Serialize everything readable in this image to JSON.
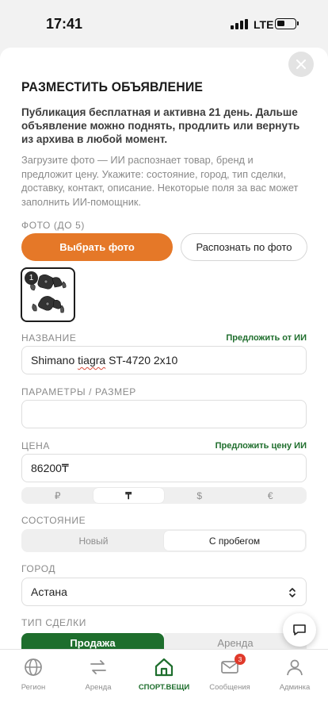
{
  "status_bar": {
    "time": "17:41",
    "network": "LTE"
  },
  "form": {
    "title": "РАЗМЕСТИТЬ ОБЪЯВЛЕНИЕ",
    "lead": "Публикация бесплатная и активна 21 день. Дальше объявление можно поднять, продлить или вернуть из архива в любой момент.",
    "hint": "Загрузите фото — ИИ распознает товар, бренд и предложит цену. Укажите: состояние, город, тип сделки, доставку, контакт, описание. Некоторые поля за вас может заполнить ИИ-помощник.",
    "photo": {
      "label": "ФОТО (ДО 5)",
      "choose_button": "Выбрать фото",
      "recognize_button": "Распознать по фото",
      "thumbnail_index": "1"
    },
    "name": {
      "label": "НАЗВАНИЕ",
      "ai_link": "Предложить от ИИ",
      "value_brand": "Shimano",
      "value_spell": "tiagra",
      "value_rest": "ST-4720 2x10"
    },
    "params": {
      "label": "ПАРАМЕТРЫ / РАЗМЕР",
      "value": ""
    },
    "price": {
      "label": "ЦЕНА",
      "ai_link": "Предложить цену ИИ",
      "value": "86200₸",
      "currencies": [
        "₽",
        "₸",
        "$",
        "€"
      ],
      "selected_currency": "₸"
    },
    "condition": {
      "label": "СОСТОЯНИЕ",
      "options": [
        "Новый",
        "С пробегом"
      ],
      "selected": "С пробегом"
    },
    "city": {
      "label": "ГОРОД",
      "value": "Астана"
    },
    "deal_type": {
      "label": "ТИП СДЕЛКИ",
      "options": [
        "Продажа",
        "Аренда"
      ],
      "selected": "Продажа"
    }
  },
  "tabbar": {
    "items": [
      {
        "label": "Регион",
        "icon": "globe-icon"
      },
      {
        "label": "Аренда",
        "icon": "swap-arrows-icon"
      },
      {
        "label": "СПОРТ.ВЕЩИ",
        "icon": "home-icon"
      },
      {
        "label": "Сообщения",
        "icon": "mail-icon",
        "badge": "3"
      },
      {
        "label": "Админка",
        "icon": "person-icon"
      }
    ],
    "active": "СПОРТ.ВЕЩИ"
  },
  "colors": {
    "accent_orange": "#e57828",
    "brand_green": "#1e6e2d",
    "badge_red": "#e03a2b"
  }
}
